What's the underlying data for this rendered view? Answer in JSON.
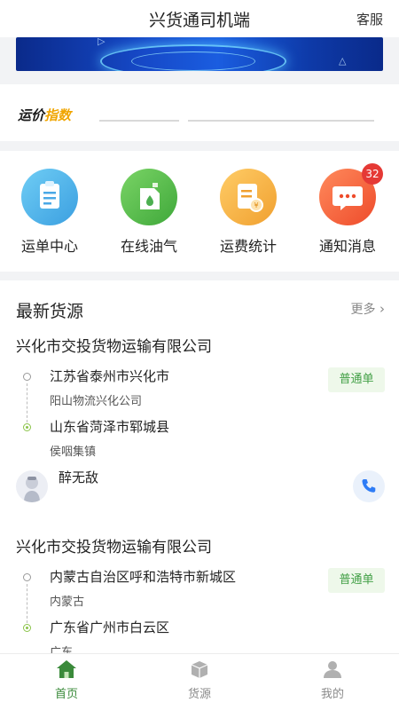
{
  "header": {
    "title": "兴货通司机端",
    "service_label": "客服"
  },
  "index_card": {
    "logo_part1": "运价",
    "logo_part2": "指数"
  },
  "grid": [
    {
      "label": "运单中心",
      "icon": "document-icon",
      "color": "#4ab3e8"
    },
    {
      "label": "在线油气",
      "icon": "oil-can-icon",
      "color": "#5cbf4a"
    },
    {
      "label": "运费统计",
      "icon": "statistics-icon",
      "color": "#f5b23c"
    },
    {
      "label": "通知消息",
      "icon": "message-icon",
      "color": "#f05a3c",
      "badge": "32"
    }
  ],
  "goods": {
    "title": "最新货源",
    "more_label": "更多",
    "items": [
      {
        "company": "兴化市交投货物运输有限公司",
        "origin": "江苏省泰州市兴化市",
        "origin_detail": "阳山物流兴化公司",
        "destination": "山东省菏泽市郓城县",
        "destination_detail": "侯咽集镇",
        "tag": "普通单",
        "owner": "醉无敌"
      },
      {
        "company": "兴化市交投货物运输有限公司",
        "origin": "内蒙古自治区呼和浩特市新城区",
        "origin_detail": "内蒙古",
        "destination": "广东省广州市白云区",
        "destination_detail": "广东",
        "tag": "普通单"
      }
    ]
  },
  "bottom_nav": [
    {
      "label": "首页",
      "icon": "home-icon",
      "active": true
    },
    {
      "label": "货源",
      "icon": "package-icon",
      "active": false
    },
    {
      "label": "我的",
      "icon": "user-icon",
      "active": false
    }
  ],
  "colors": {
    "accent": "#43a047",
    "active_nav": "#3a8a3a",
    "inactive_nav": "#8a8a8a",
    "badge": "#e53935"
  }
}
